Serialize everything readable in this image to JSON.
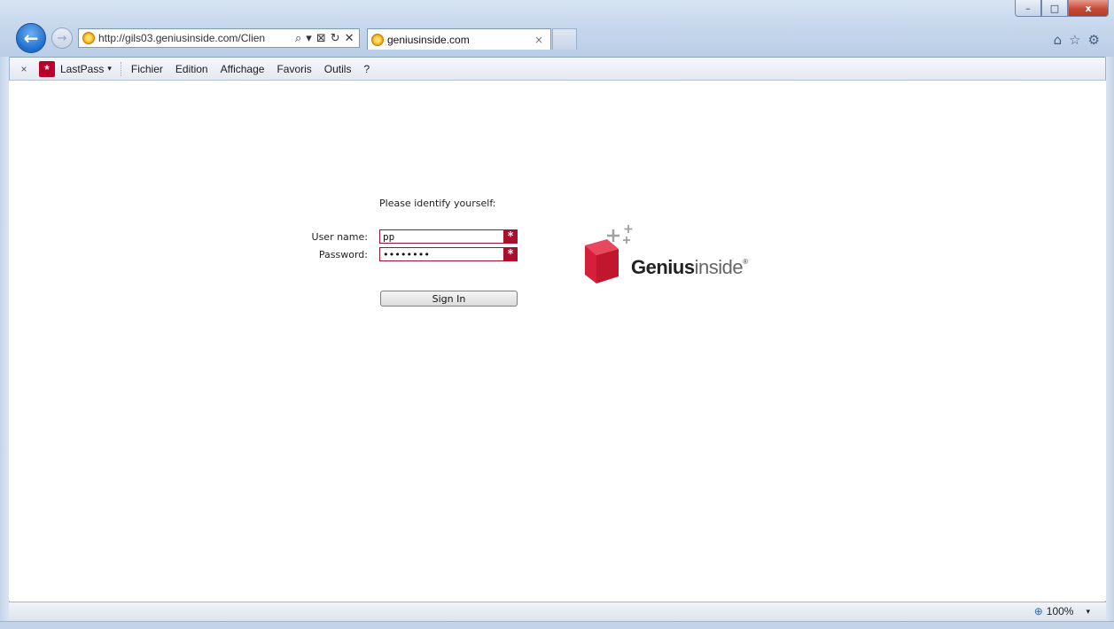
{
  "browser": {
    "window_controls": {
      "minimize": "–",
      "maximize": "□",
      "close": "x"
    },
    "address": {
      "url": "http://gils03.geniusinside.com/Clien",
      "search_icon": "search-icon",
      "search_glyph": "⌕",
      "dropdown_glyph": "▾",
      "compat_glyph": "⊠",
      "refresh_glyph": "↻",
      "stop_glyph": "✕"
    },
    "tab": {
      "title": "geniusinside.com",
      "close_glyph": "×"
    },
    "right_icons": {
      "home": "⌂",
      "favorites": "☆",
      "tools": "⚙"
    }
  },
  "menubar": {
    "close_glyph": "×",
    "lastpass_label": "LastPass",
    "lastpass_icon_glyph": "*",
    "items": [
      "Fichier",
      "Edition",
      "Affichage",
      "Favoris",
      "Outils",
      "?"
    ]
  },
  "login": {
    "prompt": "Please identify yourself:",
    "username_label": "User name:",
    "username_value": "pp",
    "password_label": "Password:",
    "password_value": "••••••••",
    "required_glyph": "*",
    "signin_label": "Sign In"
  },
  "logo": {
    "bold": "Genius",
    "light": "inside",
    "reg": "®"
  },
  "statusbar": {
    "zoom_glyph": "⊕",
    "zoom_label": "100%",
    "caret": "▾"
  },
  "colors": {
    "accent": "#a8102c",
    "logo_red": "#d61f3a"
  }
}
